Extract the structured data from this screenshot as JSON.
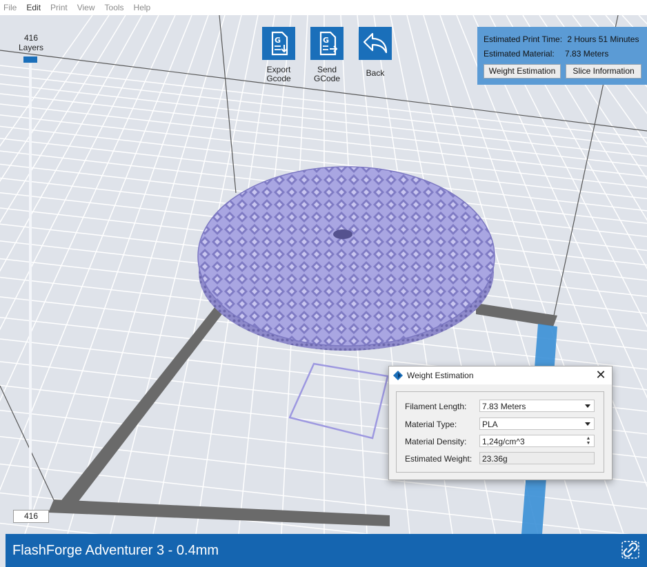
{
  "menu": {
    "items": [
      "File",
      "Edit",
      "Print",
      "View",
      "Tools",
      "Help"
    ]
  },
  "toolbar": {
    "export": {
      "label_line1": "Export",
      "label_line2": "Gcode",
      "icon": "export-gcode-icon"
    },
    "send": {
      "label_line1": "Send",
      "label_line2": "GCode",
      "icon": "send-gcode-icon"
    },
    "back": {
      "label": "Back",
      "icon": "back-arrow-icon"
    }
  },
  "info_panel": {
    "print_time_label": "Estimated Print Time:",
    "print_time_value": "2 Hours 51 Minutes",
    "material_label": "Estimated Material:",
    "material_value": "7.83 Meters",
    "weight_button": "Weight Estimation",
    "slice_button": "Slice Information"
  },
  "layers": {
    "count": "416",
    "label": "Layers",
    "current": "416"
  },
  "weight_dialog": {
    "title": "Weight Estimation",
    "filament_length_label": "Filament Length:",
    "filament_length_value": "7.83 Meters",
    "material_type_label": "Material Type:",
    "material_type_value": "PLA",
    "material_density_label": "Material Density:",
    "material_density_value": "1,24g/cm^3",
    "estimated_weight_label": "Estimated Weight:",
    "estimated_weight_value": "23.36g"
  },
  "status": {
    "printer": "FlashForge Adventurer 3 - 0.4mm"
  },
  "colors": {
    "accent": "#1a6fba",
    "status_bar": "#1565b0",
    "info_panel": "#5b9bd5",
    "model": "#a9a6e2",
    "bed": "#dfe3ea"
  }
}
